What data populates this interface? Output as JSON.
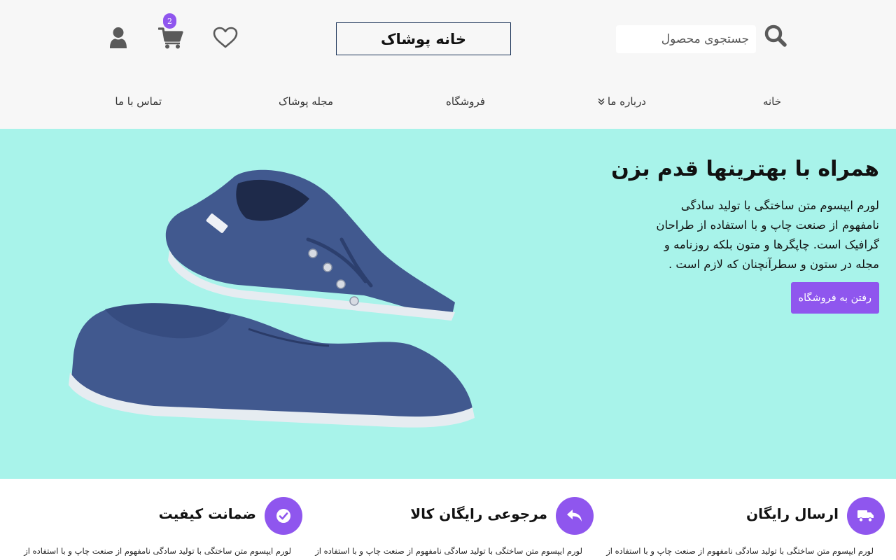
{
  "header": {
    "search_placeholder": "جستجوی محصول",
    "logo_text": "خانه پوشاک",
    "cart_count": "2"
  },
  "nav": {
    "home": "خانه",
    "about": "درباره ما",
    "shop": "فروشگاه",
    "magazine": "مجله پوشاک",
    "contact": "تماس با ما"
  },
  "hero": {
    "title": "همراه با بهترینها قدم بزن",
    "text": "لورم ایپسوم متن ساختگی با تولید سادگی نامفهوم از صنعت چاپ و با استفاده از طراحان گرافیک است. چاپگرها و متون بلکه روزنامه و مجله در ستون و سطرآنچنان که لازم است .",
    "button_label": "رفتن به فروشگاه"
  },
  "features": [
    {
      "title": "ارسال رایگان",
      "text": "لورم ایپسوم متن ساختگی با تولید سادگی نامفهوم از صنعت چاپ و با استفاده از",
      "icon": "truck-icon"
    },
    {
      "title": "مرجوعی رایگان کالا",
      "text": "لورم ایپسوم متن ساختگی با تولید سادگی نامفهوم از صنعت چاپ و با استفاده از",
      "icon": "reply-icon"
    },
    {
      "title": "ضمانت کیفیت",
      "text": "لورم ایپسوم متن ساختگی با تولید سادگی نامفهوم از صنعت چاپ و با استفاده از",
      "icon": "check-circle-icon"
    }
  ],
  "colors": {
    "accent": "#8f56ee",
    "hero_bg": "#a8f3ea",
    "header_bg": "#f7f7f7",
    "icon_gray": "#5a5a5a"
  }
}
